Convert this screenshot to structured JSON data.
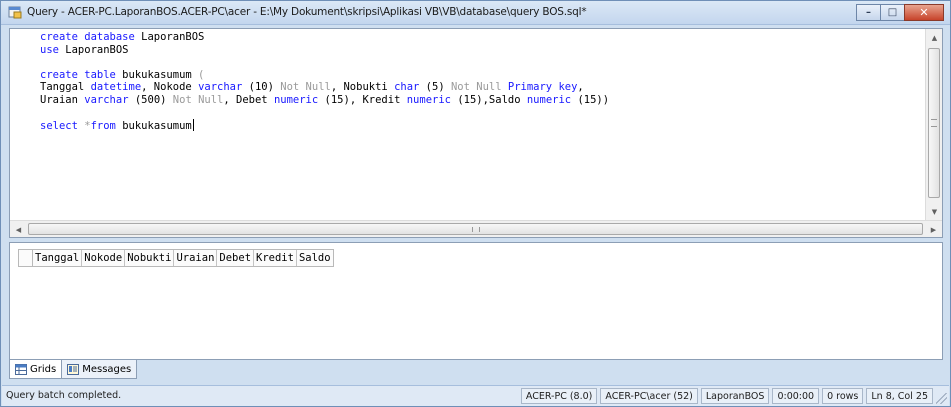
{
  "window": {
    "title": "Query - ACER-PC.LaporanBOS.ACER-PC\\acer - E:\\My Dokument\\skripsi\\Aplikasi VB\\VB\\database\\query BOS.sql*",
    "minimize_glyph": "–",
    "maximize_glyph": "□",
    "close_glyph": "✕"
  },
  "editor": {
    "lines": [
      [
        {
          "t": "create database",
          "c": "kw"
        },
        {
          "t": " LaporanBOS",
          "c": ""
        }
      ],
      [
        {
          "t": "use",
          "c": "kw"
        },
        {
          "t": " LaporanBOS",
          "c": ""
        }
      ],
      [],
      [
        {
          "t": "create table",
          "c": "kw"
        },
        {
          "t": " bukukasumum ",
          "c": ""
        },
        {
          "t": "(",
          "c": "gr"
        }
      ],
      [
        {
          "t": "Tanggal ",
          "c": ""
        },
        {
          "t": "datetime",
          "c": "kw"
        },
        {
          "t": ", Nokode ",
          "c": ""
        },
        {
          "t": "varchar",
          "c": "kw"
        },
        {
          "t": " (10) ",
          "c": ""
        },
        {
          "t": "Not Null",
          "c": "gr"
        },
        {
          "t": ", Nobukti ",
          "c": ""
        },
        {
          "t": "char",
          "c": "kw"
        },
        {
          "t": " (5) ",
          "c": ""
        },
        {
          "t": "Not Null",
          "c": "gr"
        },
        {
          "t": " ",
          "c": ""
        },
        {
          "t": "Primary key",
          "c": "kw"
        },
        {
          "t": ",",
          "c": ""
        }
      ],
      [
        {
          "t": "Uraian ",
          "c": ""
        },
        {
          "t": "varchar",
          "c": "kw"
        },
        {
          "t": " (500) ",
          "c": ""
        },
        {
          "t": "Not Null",
          "c": "gr"
        },
        {
          "t": ", Debet ",
          "c": ""
        },
        {
          "t": "numeric",
          "c": "kw"
        },
        {
          "t": " (15), Kredit ",
          "c": ""
        },
        {
          "t": "numeric",
          "c": "kw"
        },
        {
          "t": " (15),Saldo ",
          "c": ""
        },
        {
          "t": "numeric",
          "c": "kw"
        },
        {
          "t": " (15))",
          "c": ""
        }
      ],
      [],
      [
        {
          "t": "select",
          "c": "kw"
        },
        {
          "t": " *",
          "c": "gr"
        },
        {
          "t": "from",
          "c": "kw"
        },
        {
          "t": " bukukasumum",
          "c": ""
        }
      ]
    ],
    "scroll_h_center_glyph": "III"
  },
  "results": {
    "columns": [
      "Tanggal",
      "Nokode",
      "Nobukti",
      "Uraian",
      "Debet",
      "Kredit",
      "Saldo"
    ]
  },
  "tabs": [
    {
      "label": "Grids",
      "icon": "grid-icon",
      "active": true
    },
    {
      "label": "Messages",
      "icon": "messages-icon",
      "active": false
    }
  ],
  "status": {
    "message": "Query batch completed.",
    "panels": [
      "ACER-PC (8.0)",
      "ACER-PC\\acer (52)",
      "LaporanBOS",
      "0:00:00",
      "0 rows",
      "Ln 8, Col 25"
    ]
  },
  "colors": {
    "keyword": "#1818ff",
    "operator": "#9a9a9a"
  }
}
